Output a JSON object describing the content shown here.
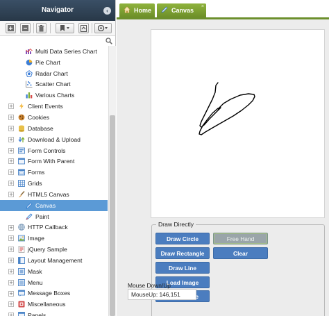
{
  "navigator": {
    "title": "Navigator",
    "toolbar": {
      "buttons": [
        "expand-all",
        "collapse-all",
        "delete",
        "bookmark-dropdown",
        "export",
        "settings-dropdown"
      ]
    },
    "tree": [
      {
        "label": "Multi Data Series Chart",
        "level": "child",
        "icon": "multi-series-chart-icon",
        "color": "#7a3fb0"
      },
      {
        "label": "Pie Chart",
        "level": "child",
        "icon": "pie-chart-icon",
        "color": "#3d7ed6"
      },
      {
        "label": "Radar Chart",
        "level": "child",
        "icon": "radar-chart-icon",
        "color": "#3d7ed6"
      },
      {
        "label": "Scatter Chart",
        "level": "child",
        "icon": "scatter-chart-icon",
        "color": "#3d7ed6"
      },
      {
        "label": "Various Charts",
        "level": "child",
        "icon": "various-charts-icon",
        "color": "#3d7ed6"
      },
      {
        "label": "Client Events",
        "level": "top",
        "icon": "lightning-icon",
        "color": "#f2b12a"
      },
      {
        "label": "Cookies",
        "level": "top",
        "icon": "cookie-icon",
        "color": "#c8812e"
      },
      {
        "label": "Database",
        "level": "top",
        "icon": "database-icon",
        "color": "#e8c04a"
      },
      {
        "label": "Download & Upload",
        "level": "top",
        "icon": "download-upload-icon",
        "color": "#3d7ed6"
      },
      {
        "label": "Form Controls",
        "level": "top",
        "icon": "form-controls-icon",
        "color": "#4a84c8"
      },
      {
        "label": "Form With Parent",
        "level": "top",
        "icon": "form-with-parent-icon",
        "color": "#4a84c8"
      },
      {
        "label": "Forms",
        "level": "top",
        "icon": "forms-icon",
        "color": "#4a84c8"
      },
      {
        "label": "Grids",
        "level": "top",
        "icon": "grid-icon",
        "color": "#4a84c8"
      },
      {
        "label": "HTML5 Canvas",
        "level": "top",
        "icon": "paintbrush-icon",
        "color": "#d8913a"
      },
      {
        "label": "Canvas",
        "level": "child",
        "icon": "canvas-pen-icon",
        "color": "#2f7bd0",
        "selected": true
      },
      {
        "label": "Paint",
        "level": "child",
        "icon": "paint-pen-icon",
        "color": "#2f7bd0"
      },
      {
        "label": "HTTP Callback",
        "level": "top",
        "icon": "globe-icon",
        "color": "#6e8fb0"
      },
      {
        "label": "Image",
        "level": "top",
        "icon": "image-icon",
        "color": "#5d8fc9"
      },
      {
        "label": "jQuery Sample",
        "level": "top",
        "icon": "jquery-icon",
        "color": "#d24b4b"
      },
      {
        "label": "Layout Management",
        "level": "top",
        "icon": "layout-icon",
        "color": "#4a84c8"
      },
      {
        "label": "Mask",
        "level": "top",
        "icon": "mask-icon",
        "color": "#4a84c8"
      },
      {
        "label": "Menu",
        "level": "top",
        "icon": "menu-icon",
        "color": "#4a84c8"
      },
      {
        "label": "Message Boxes",
        "level": "top",
        "icon": "message-box-icon",
        "color": "#4a84c8"
      },
      {
        "label": "Miscellaneous",
        "level": "top",
        "icon": "miscellaneous-icon",
        "color": "#d24b4b"
      },
      {
        "label": "Panels",
        "level": "top",
        "icon": "panels-icon",
        "color": "#4a84c8"
      }
    ]
  },
  "tabs": [
    {
      "label": "Home",
      "icon": "home-icon"
    },
    {
      "label": "Canvas",
      "icon": "canvas-pen-icon",
      "close": "×"
    }
  ],
  "draw_panel": {
    "legend": "Draw Directly",
    "buttons": {
      "draw_circle": "Draw Circle",
      "free_hand": "Free Hand",
      "draw_rectangle": "Draw Rectangle",
      "clear": "Clear",
      "draw_line": "Draw Line",
      "load_image": "Load Image",
      "save_image": "Save Image"
    },
    "mouse_label": "Mouse Down/Up",
    "mouse_value": "MouseUp: 146,151"
  },
  "colors": {
    "accent_green": "#6d8f28",
    "button_blue": "#4b7dbf",
    "selected_row": "#5b9ad6",
    "header_dark": "#2f4254"
  }
}
